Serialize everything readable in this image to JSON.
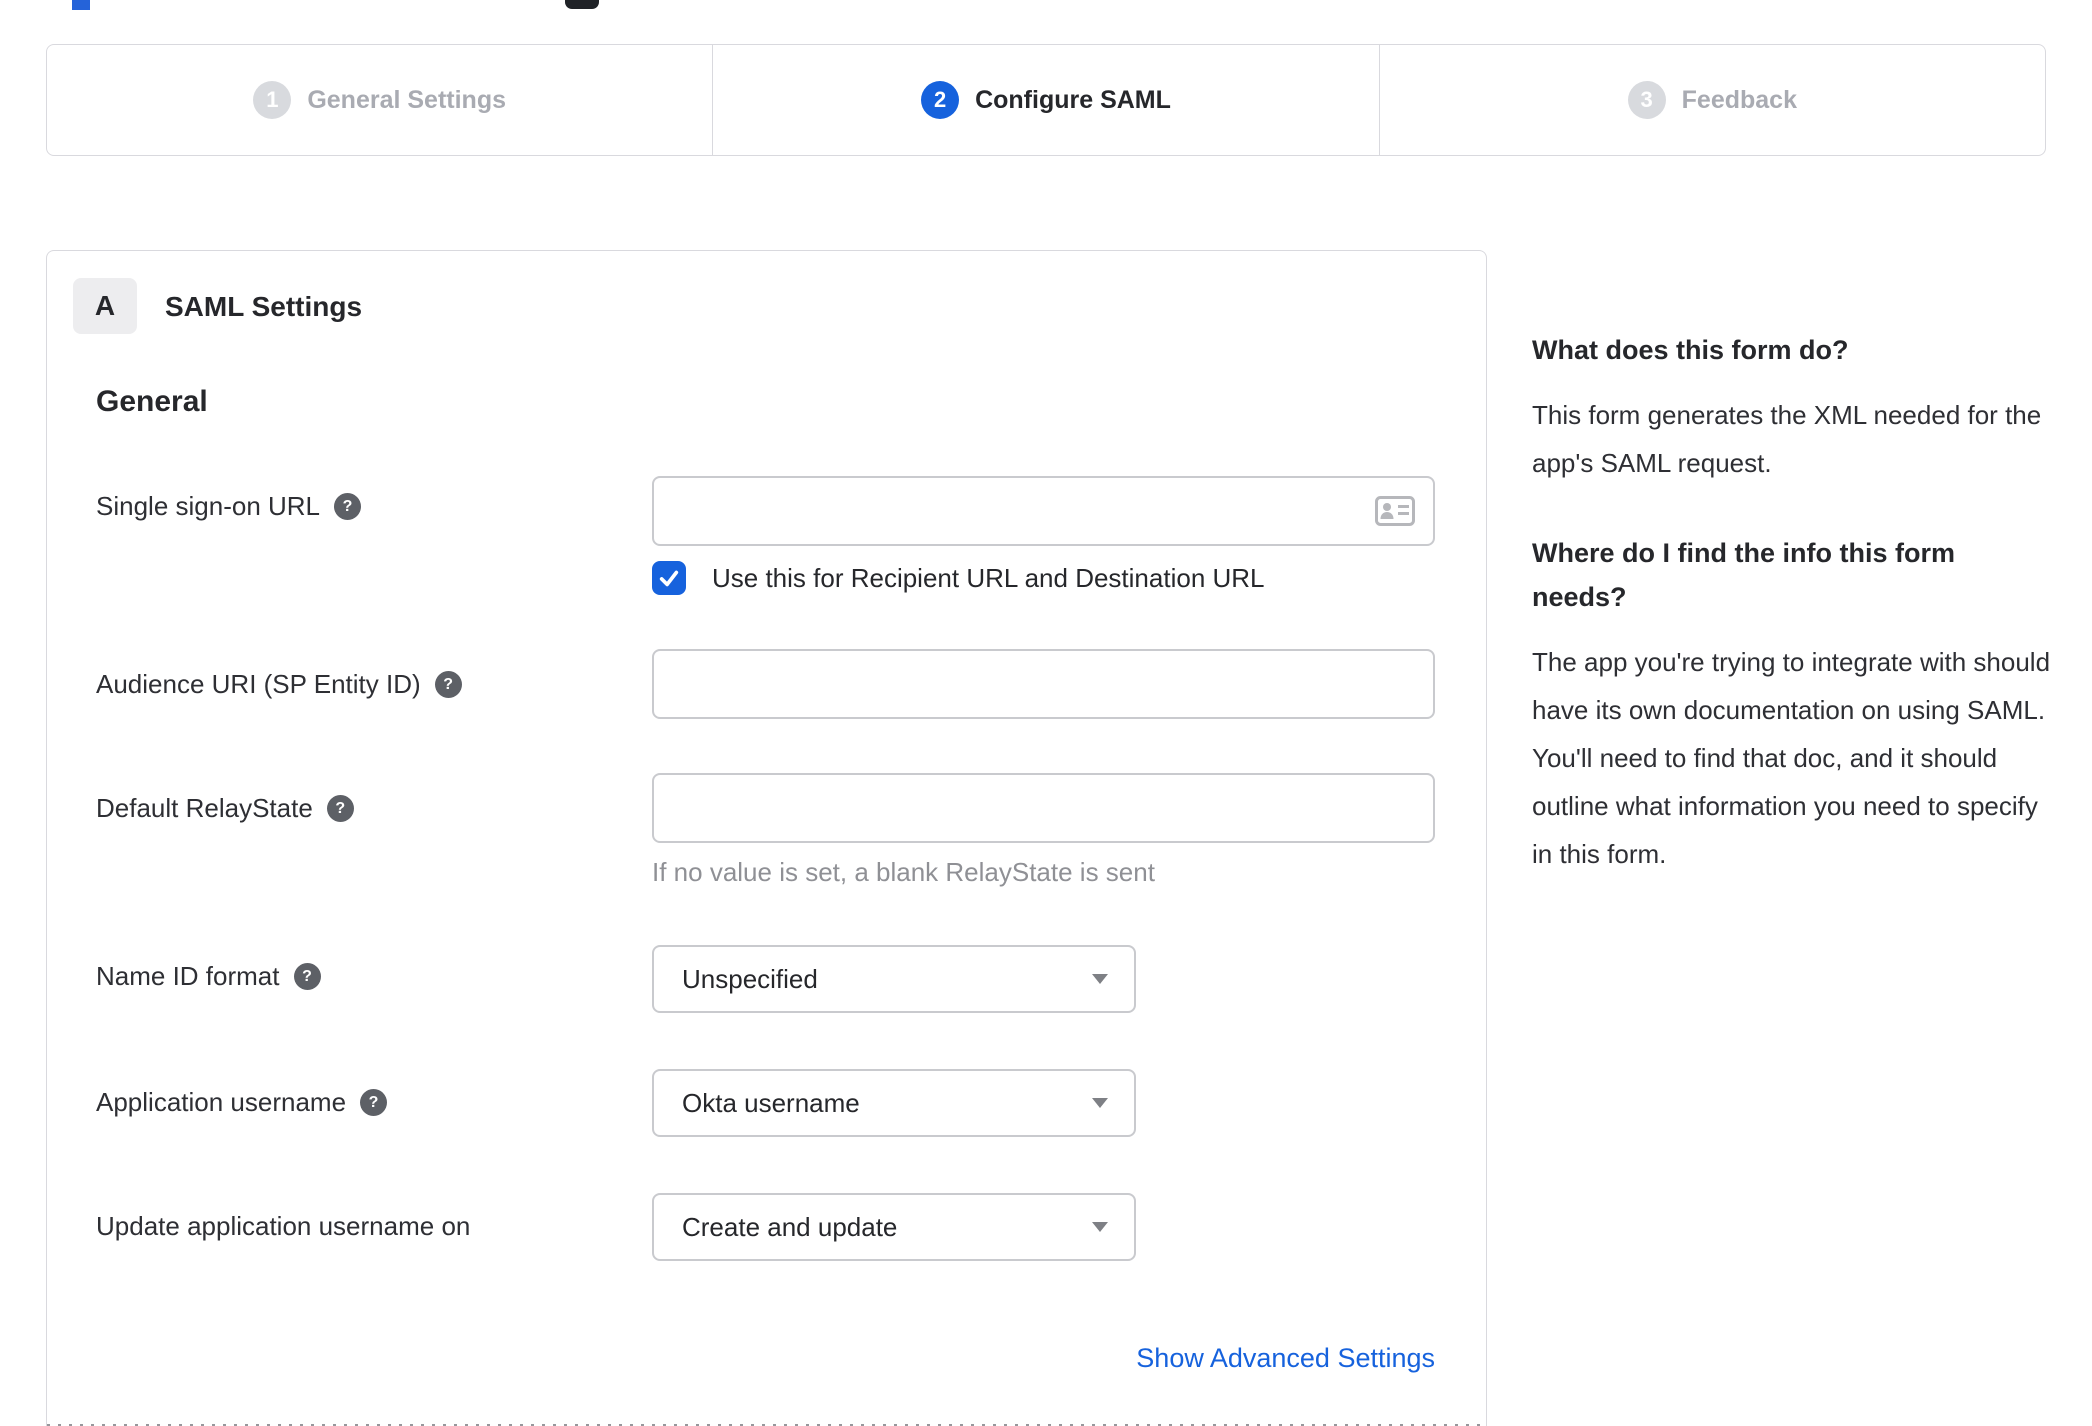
{
  "colors": {
    "accent_blue": "#1662dd",
    "inactive_gray": "#a9abb2",
    "border_gray": "#d9d9de",
    "hint_gray": "#8f9095"
  },
  "stepper": {
    "steps": [
      {
        "number": "1",
        "label": "General Settings",
        "state": "inactive"
      },
      {
        "number": "2",
        "label": "Configure SAML",
        "state": "active"
      },
      {
        "number": "3",
        "label": "Feedback",
        "state": "inactive"
      }
    ]
  },
  "panel": {
    "section_badge": "A",
    "section_title": "SAML Settings",
    "group_title": "General",
    "fields": [
      {
        "label": "Single sign-on URL",
        "type": "text",
        "value": "",
        "checkbox": {
          "checked": true,
          "label": "Use this for Recipient URL and Destination URL"
        }
      },
      {
        "label": "Audience URI (SP Entity ID)",
        "type": "text",
        "value": ""
      },
      {
        "label": "Default RelayState",
        "type": "text",
        "value": "",
        "hint": "If no value is set, a blank RelayState is sent"
      },
      {
        "label": "Name ID format",
        "type": "select",
        "value": "Unspecified"
      },
      {
        "label": "Application username",
        "type": "select",
        "value": "Okta username"
      },
      {
        "label": "Update application username on",
        "type": "select",
        "value": "Create and update"
      }
    ],
    "advanced_link": "Show Advanced Settings"
  },
  "sidebar": {
    "blocks": [
      {
        "heading": "What does this form do?",
        "body": "This form generates the XML needed for the app's SAML request."
      },
      {
        "heading": "Where do I find the info this form needs?",
        "body": "The app you're trying to integrate with should have its own documentation on using SAML. You'll need to find that doc, and it should outline what information you need to specify in this form."
      }
    ]
  }
}
